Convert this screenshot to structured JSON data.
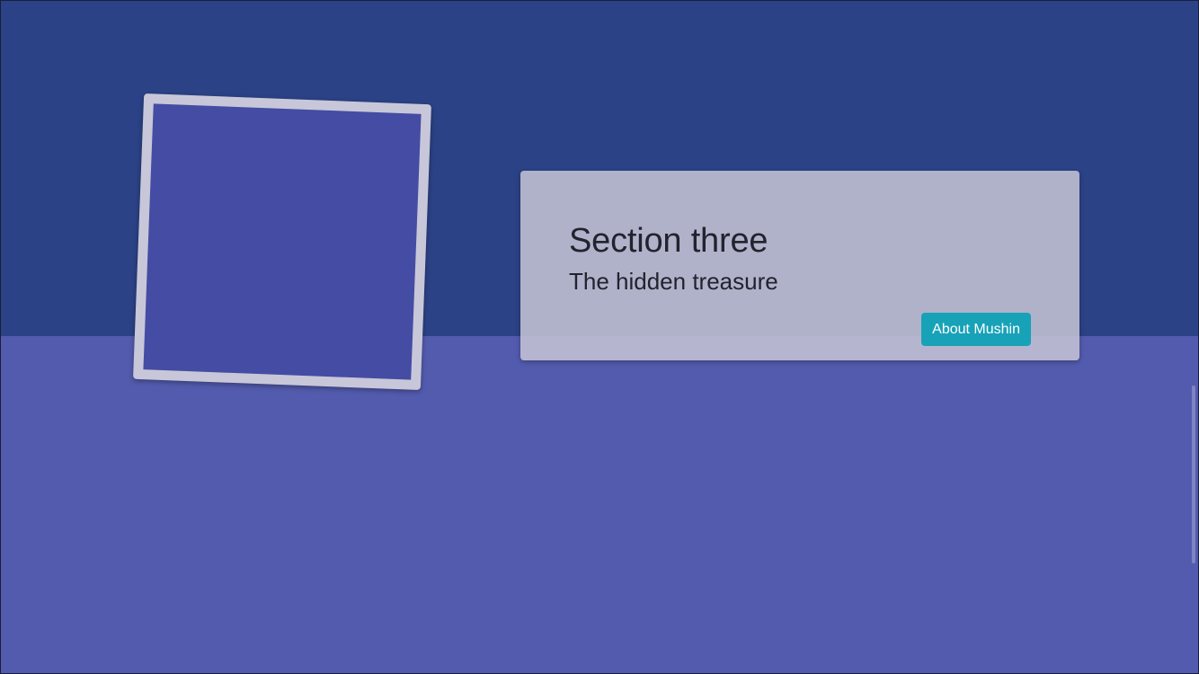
{
  "colors": {
    "top_band": "#2b4286",
    "bottom_band": "#535bae",
    "photo_frame": "#c8c7d9",
    "photo_fill": "#454ca3",
    "button": "#17a2b8"
  },
  "section": {
    "title": "Section three",
    "subtitle": "The hidden treasure",
    "button_label": "About Mushin"
  }
}
